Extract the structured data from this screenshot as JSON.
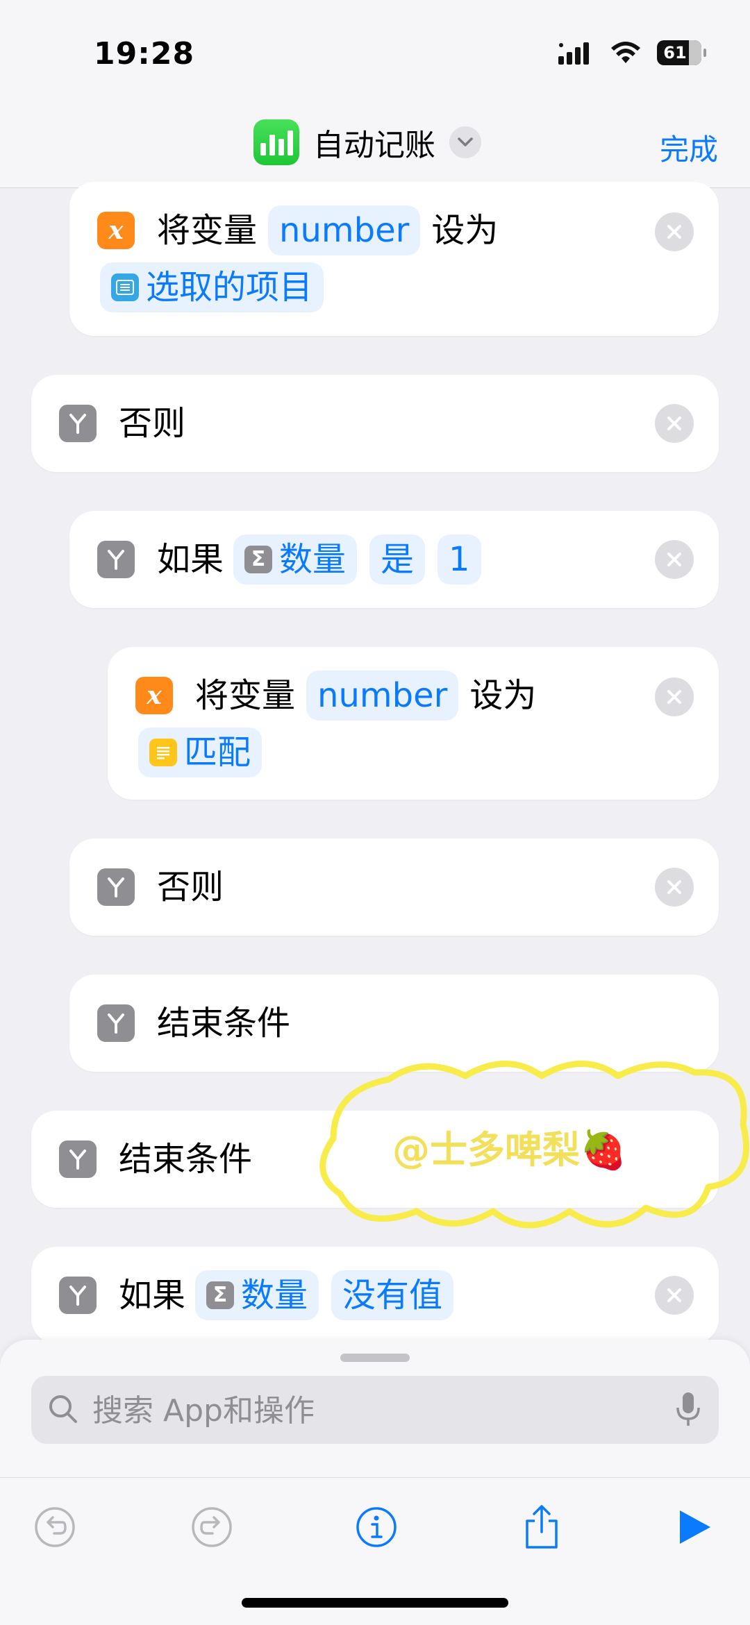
{
  "status_bar": {
    "time": "19:28",
    "battery": "61"
  },
  "nav": {
    "title": "自动记账",
    "done_label": "完成"
  },
  "actions": [
    {
      "icon": "x-variable-icon",
      "text1": "将变量",
      "token1": "number",
      "text2": "设为",
      "token2": "选取的项目",
      "token2_icon": "list-icon"
    },
    {
      "icon": "branch-icon",
      "text1": "否则"
    },
    {
      "icon": "branch-icon",
      "text1": "如果",
      "token1": "数量",
      "token1_icon": "sigma-icon",
      "token2": "是",
      "token3": "1"
    },
    {
      "icon": "x-variable-icon",
      "text1": "将变量",
      "token1": "number",
      "text2": "设为",
      "token2": "匹配",
      "token2_icon": "text-icon"
    },
    {
      "icon": "branch-icon",
      "text1": "否则"
    },
    {
      "icon": "branch-icon",
      "text1": "结束条件"
    },
    {
      "icon": "branch-icon",
      "text1": "结束条件"
    },
    {
      "icon": "branch-icon",
      "text1": "如果",
      "token1": "数量",
      "token1_icon": "sigma-icon",
      "token2": "没有值"
    }
  ],
  "watermark": {
    "text": "@士多啤梨🍓"
  },
  "search": {
    "placeholder": "搜索 App和操作"
  },
  "colors": {
    "accent": "#0a7aff",
    "variable": "#ff8a1a",
    "branch": "#8e8e93",
    "token_bg": "#e8f2ff",
    "watermark": "#f2e05a"
  }
}
